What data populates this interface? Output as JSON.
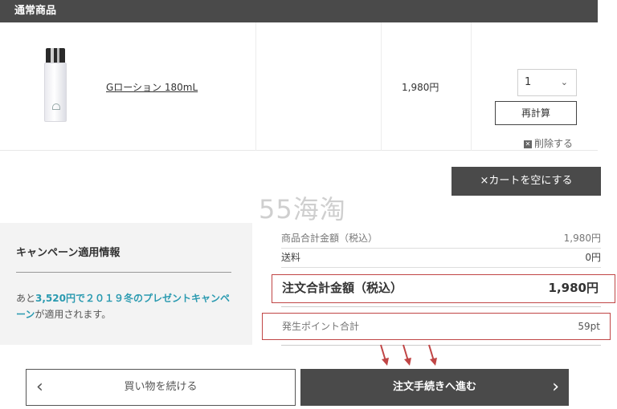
{
  "section_header": "通常商品",
  "product": {
    "name": "Gローション 180mL",
    "price": "1,980円",
    "quantity": "1",
    "recalc_label": "再計算",
    "delete_label": "削除する"
  },
  "empty_cart_label": "×カートを空にする",
  "watermark": "55海淘",
  "campaign": {
    "title": "キャンペーン適用情報",
    "text_prefix": "あと",
    "text_highlight": "3,520円で２０１９冬のプレゼントキャンペーン",
    "text_suffix": "が適用されます。"
  },
  "summary": {
    "subtotal_label": "商品合計金額（税込）",
    "subtotal_value": "1,980円",
    "shipping_label": "送料",
    "shipping_value": "0円",
    "total_label": "注文合計金額（税込）",
    "total_value": "1,980円",
    "points_label": "発生ポイント合計",
    "points_value": "59pt"
  },
  "buttons": {
    "continue_label": "買い物を続ける",
    "checkout_label": "注文手続きへ進む"
  },
  "colors": {
    "dark_gray": "#4a4a4a",
    "highlight_teal": "#2a9ab0",
    "annotation_red": "#c04545"
  }
}
